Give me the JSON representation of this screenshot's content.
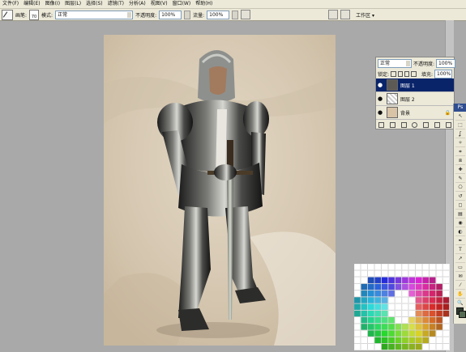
{
  "menu": [
    "文件(F)",
    "编辑(E)",
    "图像(I)",
    "图层(L)",
    "选择(S)",
    "滤镜(T)",
    "分析(A)",
    "视图(V)",
    "窗口(W)",
    "帮助(H)"
  ],
  "options": {
    "brush_label": "画笔:",
    "brush_size": "70",
    "mode_label": "模式:",
    "mode_value": "正常",
    "opacity_label": "不透明度:",
    "opacity_value": "100%",
    "flow_label": "流量:",
    "flow_value": "100%",
    "workspace_label": "工作区 ▾"
  },
  "layers_panel": {
    "blend_mode": "正常",
    "opacity_label": "不透明度:",
    "opacity_value": "100%",
    "lock_label": "锁定:",
    "fill_label": "填充:",
    "fill_value": "100%",
    "layers": [
      {
        "name": "图层 1",
        "active": true
      },
      {
        "name": "图层 2",
        "active": false
      },
      {
        "name": "背景",
        "active": false
      }
    ]
  },
  "toolbox": {
    "title": "Ps",
    "tools": [
      "move-tool",
      "marquee-tool",
      "lasso-tool",
      "magic-wand-tool",
      "crop-tool",
      "slice-tool",
      "healing-tool",
      "brush-tool",
      "clone-stamp-tool",
      "history-brush-tool",
      "eraser-tool",
      "gradient-tool",
      "blur-tool",
      "dodge-tool",
      "pen-tool",
      "type-tool",
      "path-select-tool",
      "shape-tool",
      "notes-tool",
      "eyedropper-tool",
      "hand-tool",
      "zoom-tool"
    ],
    "foreground_color": "#2f3b2f",
    "background_color": "#556a52"
  },
  "colors": {
    "canvas_bg": "#d8cbb6",
    "selected_layer": "#0a246a"
  }
}
